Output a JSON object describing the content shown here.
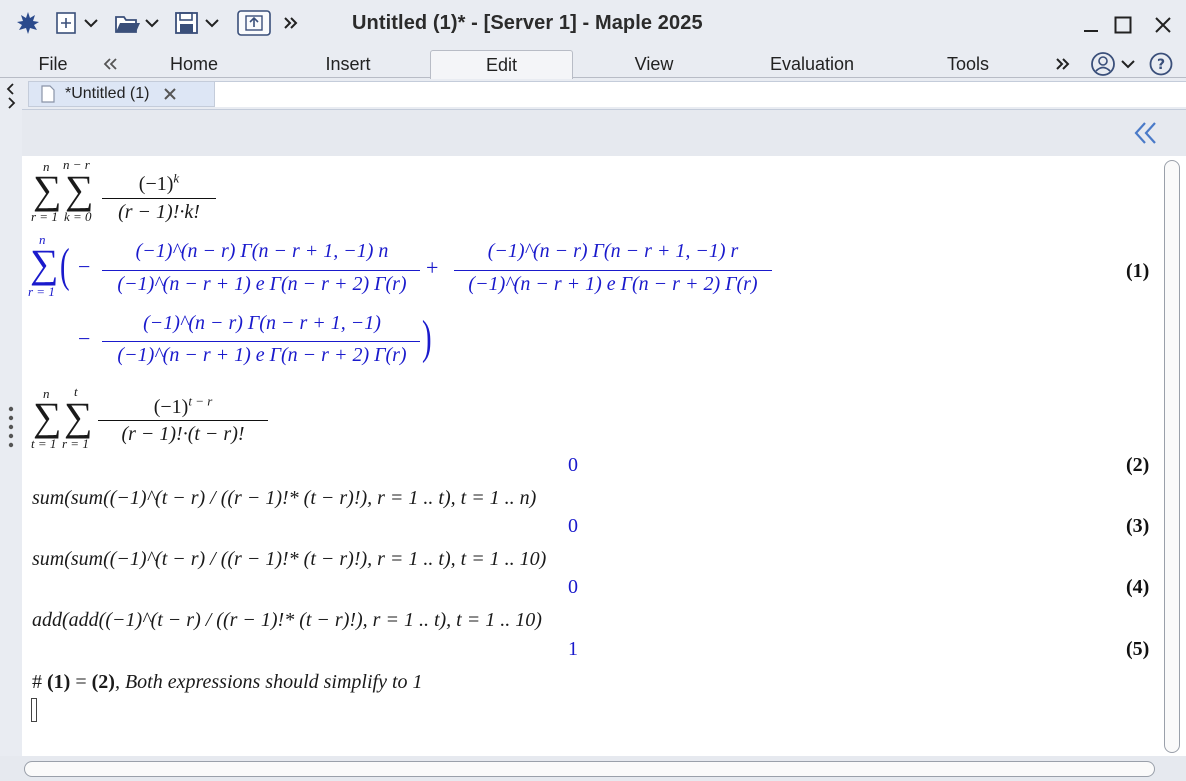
{
  "window": {
    "title": "Untitled (1)* - [Server 1] - Maple 2025"
  },
  "icons": {
    "app": "maple-leaf-icon",
    "new": "new-document-icon",
    "open": "open-folder-icon",
    "save": "save-icon",
    "export": "export-icon",
    "more": "double-chevron-right-icon",
    "minimize": "minimize-icon",
    "maximize": "maximize-icon",
    "close": "close-icon",
    "account": "account-icon",
    "help": "help-icon",
    "collapse": "double-chevron-left-icon"
  },
  "menu": {
    "file": "File",
    "home": "Home",
    "insert": "Insert",
    "edit": "Edit",
    "view": "View",
    "evaluation": "Evaluation",
    "tools": "Tools"
  },
  "tabs": {
    "doc_tab_label": "*Untitled (1)"
  },
  "colors": {
    "output_blue": "#1a1acc",
    "chrome": "#e9ecf2",
    "active_tab": "#f4f5f8"
  },
  "worksheet": {
    "input1": {
      "outer_upper": "n",
      "outer_lower": "r = 1",
      "inner_upper": "n − r",
      "inner_lower": "k = 0",
      "numerator": "(−1)",
      "num_exp": "k",
      "denominator": "(r − 1)!·k!"
    },
    "output1": {
      "sum_upper": "n",
      "sum_lower": "r = 1",
      "term1_num": "(−1)^(n − r) Γ(n − r + 1, −1) n",
      "term1_den": "(−1)^(n − r + 1) e Γ(n − r + 2) Γ(r)",
      "term2_num": "(−1)^(n − r) Γ(n − r + 1, −1) r",
      "term2_den": "(−1)^(n − r + 1) e Γ(n − r + 2) Γ(r)",
      "term3_num": "(−1)^(n − r) Γ(n − r + 1, −1)",
      "term3_den": "(−1)^(n − r + 1) e Γ(n − r + 2) Γ(r)",
      "label": "(1)"
    },
    "input2": {
      "outer_upper": "n",
      "outer_lower": "t = 1",
      "inner_upper": "t",
      "inner_lower": "r = 1",
      "numerator": "(−1)",
      "num_exp": "t − r",
      "denominator": "(r − 1)!·(t − r)!"
    },
    "output2": {
      "value": "0",
      "label": "(2)"
    },
    "input3": "sum(sum((−1)^(t − r) / ((r − 1)!* (t − r)!), r = 1 .. t), t = 1 .. n)",
    "output3": {
      "value": "0",
      "label": "(3)"
    },
    "input4": "sum(sum((−1)^(t − r) / ((r − 1)!* (t − r)!), r = 1 .. t), t = 1 .. 10)",
    "output4": {
      "value": "0",
      "label": "(4)"
    },
    "input5": "add(add((−1)^(t − r) / ((r − 1)!* (t − r)!), r = 1 .. t), t = 1 .. 10)",
    "output5": {
      "value": "1",
      "label": "(5)"
    },
    "comment": {
      "hash": "#",
      "ref1": "(1)",
      "equals": "=",
      "ref2": "(2)",
      "text": ", Both expressions should simplify to 1"
    }
  }
}
